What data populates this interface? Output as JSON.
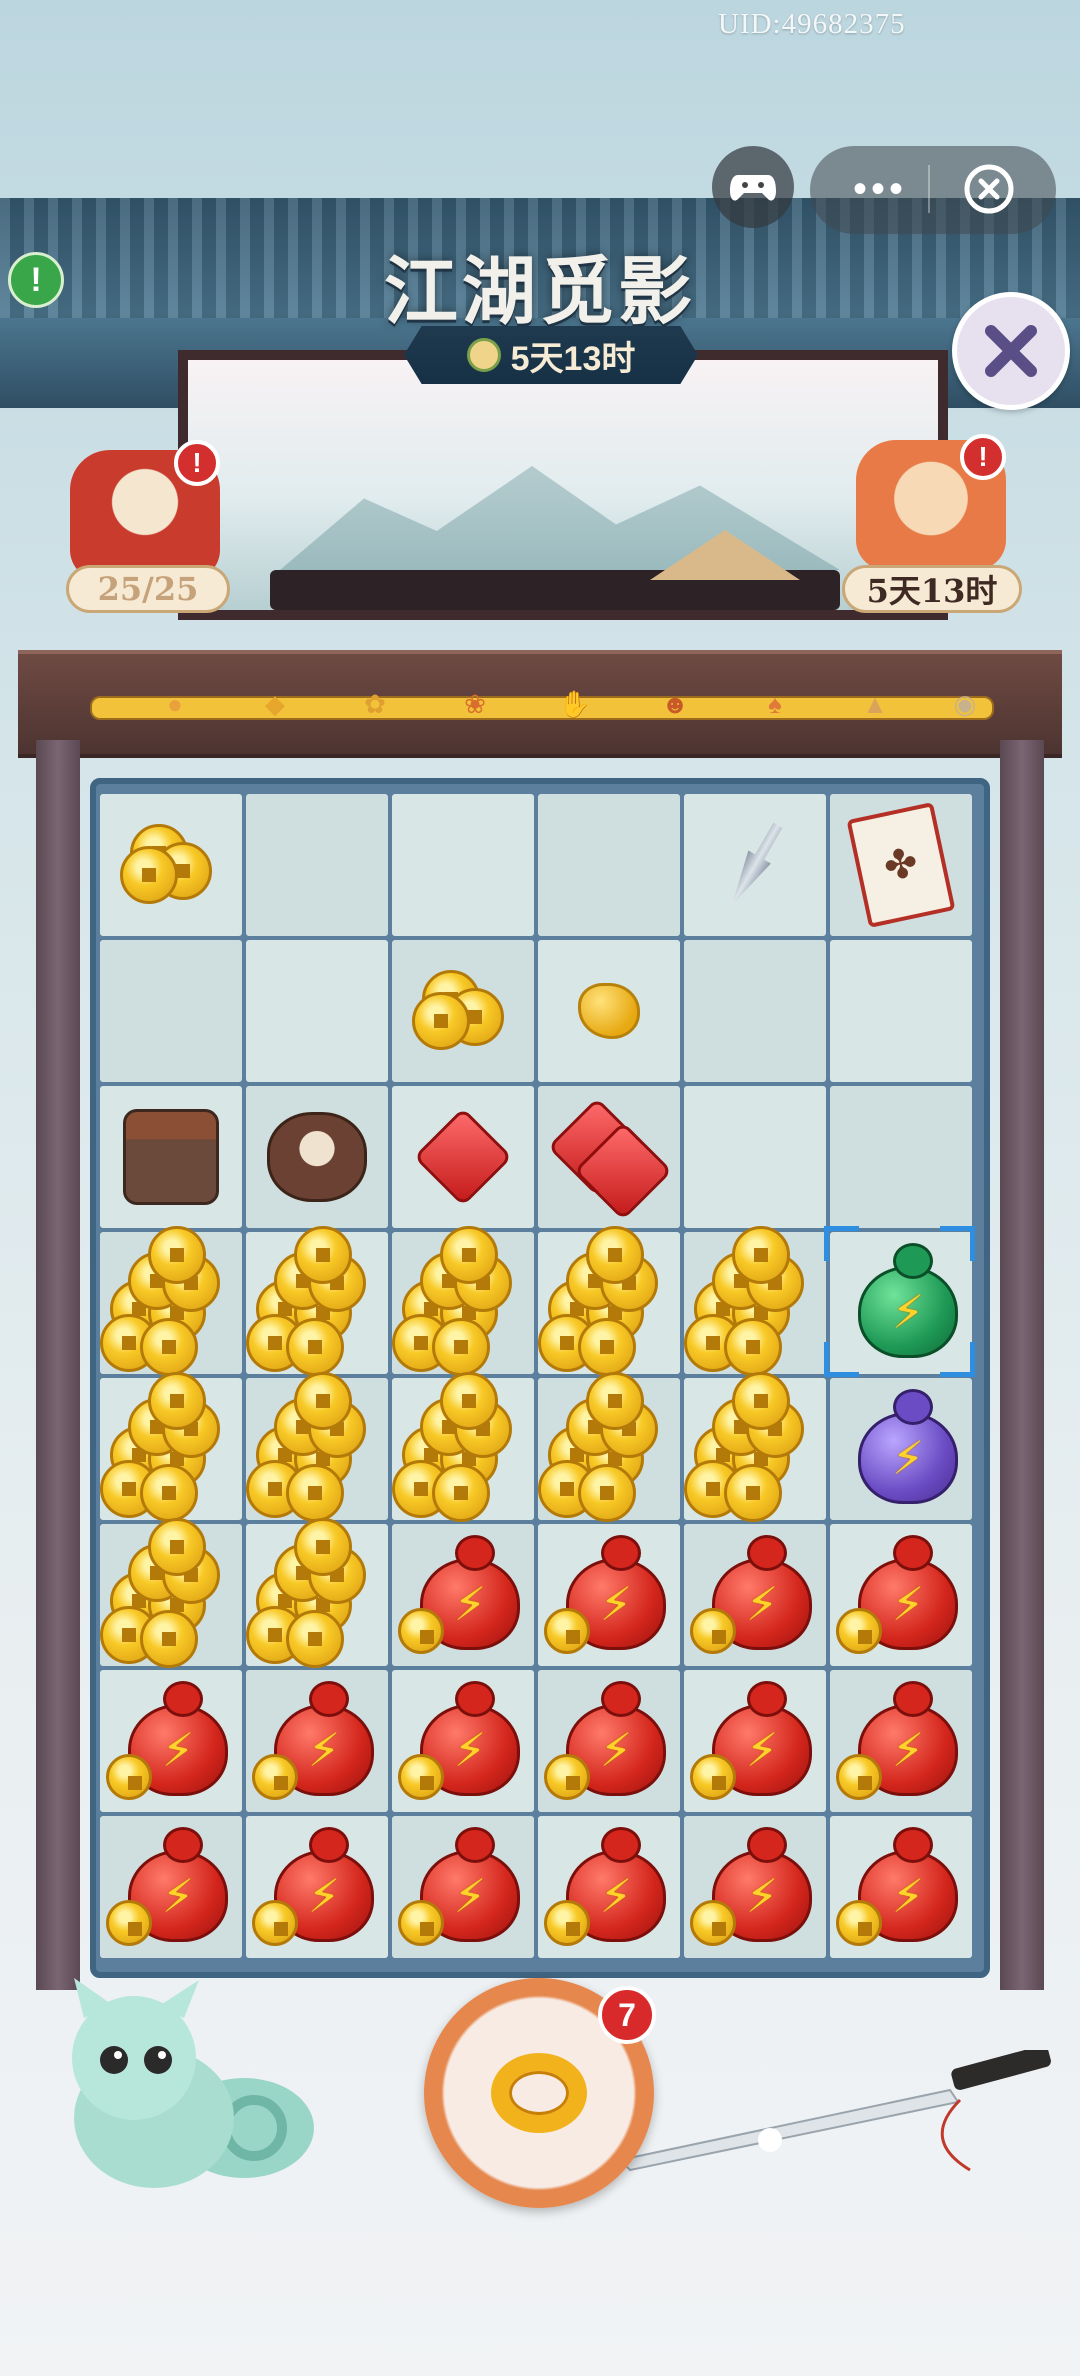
{
  "header": {
    "uid_text": "UID:49682375",
    "title": "江湖觅影",
    "timer": "5天13时"
  },
  "miniprogram": {
    "gamepad_icon": "gamepad-icon",
    "menu_icon": "more-dots-icon",
    "menu_label": "•••",
    "close_icon": "close-circle-icon"
  },
  "alert": {
    "label": "!"
  },
  "left_widget": {
    "icon": "red-envelope-icon",
    "badge": "!",
    "count": "25/25"
  },
  "right_widget": {
    "icon": "cat-with-fan-icon",
    "badge": "!",
    "timer": "5天13时"
  },
  "progress_track": {
    "items": [
      {
        "icon": "bun-icon",
        "glyph": "●"
      },
      {
        "icon": "dumpling-icon",
        "glyph": "◆"
      },
      {
        "icon": "wreath-icon",
        "glyph": "✿"
      },
      {
        "icon": "phoenix-icon",
        "glyph": "❀"
      },
      {
        "icon": "glove-icon",
        "glyph": "✋"
      },
      {
        "icon": "mask-icon",
        "glyph": "☻"
      },
      {
        "icon": "gift-bag-icon",
        "glyph": "♠"
      },
      {
        "icon": "hat-icon",
        "glyph": "▲"
      },
      {
        "icon": "coin-pouch-icon",
        "glyph": "◉"
      }
    ]
  },
  "board": {
    "rows": [
      [
        "coins-small",
        "",
        "",
        "",
        "kunai",
        "cards"
      ],
      [
        "",
        "",
        "coins-small",
        "nugget",
        "",
        ""
      ],
      [
        "pants",
        "belt",
        "gem-single",
        "gem-double",
        "",
        ""
      ],
      [
        "coins-big",
        "coins-big",
        "coins-big",
        "coins-big",
        "coins-big",
        "gourd-green-selected"
      ],
      [
        "coins-big",
        "coins-big",
        "coins-big",
        "coins-big",
        "coins-big",
        "gourd-purple"
      ],
      [
        "coins-big",
        "coins-big",
        "gourd-red",
        "gourd-red",
        "gourd-red",
        "gourd-red"
      ],
      [
        "gourd-red",
        "gourd-red",
        "gourd-red",
        "gourd-red",
        "gourd-red",
        "gourd-red"
      ],
      [
        "gourd-red",
        "gourd-red",
        "gourd-red",
        "gourd-red",
        "gourd-red",
        "gourd-red"
      ]
    ],
    "selected": {
      "row": 3,
      "col": 5
    }
  },
  "bottom": {
    "ring_button_icon": "golden-ring-icon",
    "ring_badge": "7",
    "mascot_icon": "green-cat-mascot-icon",
    "sword_icon": "sword-icon"
  },
  "colors": {
    "accent_gold": "#f2c23a",
    "badge_red": "#d32f2f",
    "select_blue": "#2e8fe0"
  }
}
